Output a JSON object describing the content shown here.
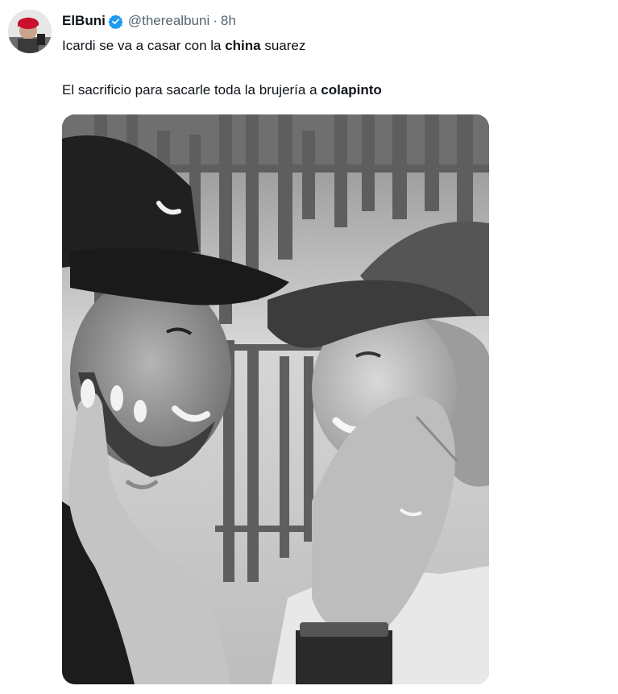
{
  "tweet": {
    "author": {
      "display_name": "ElBuni",
      "handle": "@therealbuni",
      "separator": "·",
      "time": "8h",
      "verified_icon": "verified-badge-icon",
      "verified_color": "#1d9bf0"
    },
    "text": {
      "line1_before": "Icardi se va a casar con la ",
      "line1_bold": "china",
      "line1_after": " suarez",
      "line2_before": "El sacrificio para sacarle toda la brujería a ",
      "line2_bold": "colapinto"
    },
    "media": {
      "style": "black-and-white",
      "subject": "photo-couple-in-caps"
    }
  },
  "colors": {
    "text_primary": "#0f1419",
    "text_secondary": "#536471",
    "accent": "#1d9bf0"
  }
}
